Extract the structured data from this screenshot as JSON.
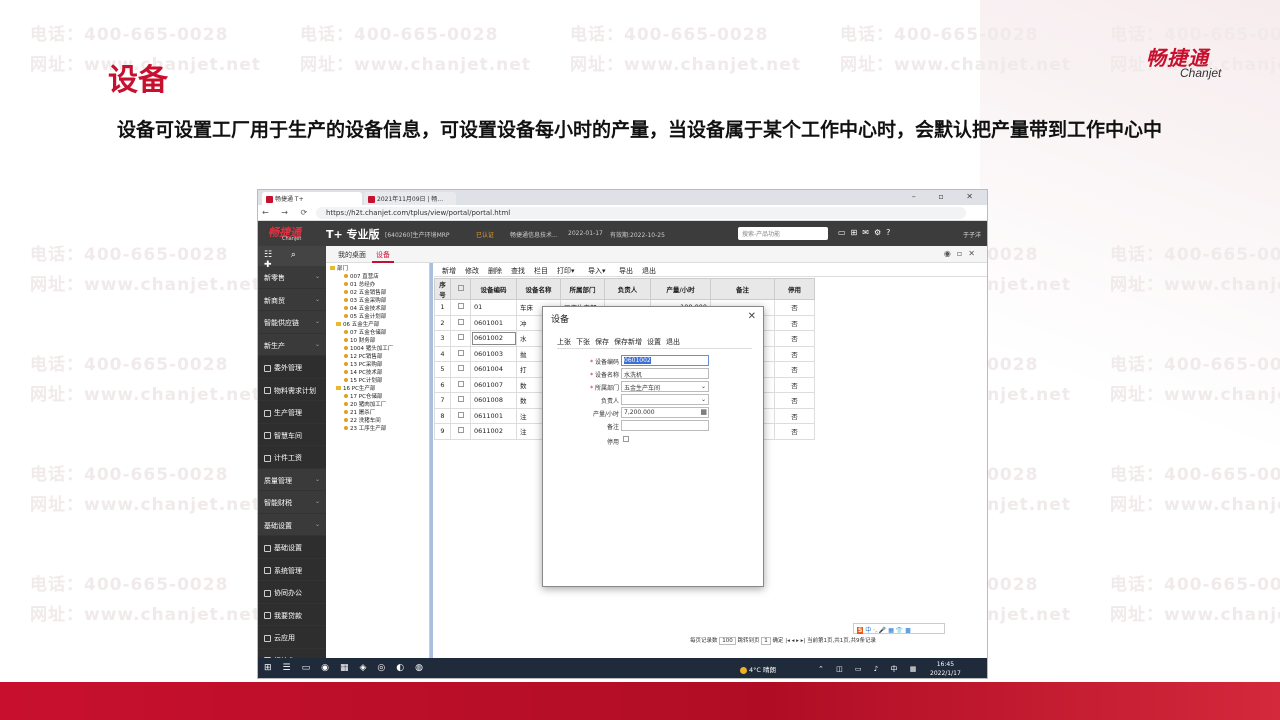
{
  "slide": {
    "title": "设备",
    "description": "设备可设置工厂用于生产的设备信息，可设置设备每小时的产量，当设备属于某个工作中心时，会默认把产量带到工作中心中",
    "logo_cn": "畅捷通",
    "logo_en": "Chanjet",
    "watermark_phone": "电话：400-665-0028",
    "watermark_site": "网址：www.chanjet.net"
  },
  "browser": {
    "tab1": "畅捷通 T+",
    "tab2": "2021年11月09日 | 畅...",
    "url": "https://h2t.chanjet.com/tplus/view/portal/portal.html"
  },
  "app": {
    "logo": "畅捷通",
    "logo_en": "Chanjet",
    "name": "T+ 专业版",
    "version": "[640260]生产环境MRP",
    "cert": "已认证",
    "company": "畅捷通信息技术...",
    "date": "2022-01-17",
    "valid": "有效期:2022-10-25",
    "search_placeholder": "搜索-产品功能",
    "user": "于子洋"
  },
  "sidebar": {
    "items": [
      {
        "label": "新零售",
        "sub": false
      },
      {
        "label": "新商贸",
        "sub": false
      },
      {
        "label": "智能供应链",
        "sub": false
      },
      {
        "label": "新生产",
        "sub": false
      },
      {
        "label": "委外管理",
        "sub": true
      },
      {
        "label": "物料需求计划",
        "sub": true
      },
      {
        "label": "生产管理",
        "sub": true
      },
      {
        "label": "智慧车间",
        "sub": true
      },
      {
        "label": "计件工资",
        "sub": true
      },
      {
        "label": "质量管理",
        "sub": false
      },
      {
        "label": "智能财税",
        "sub": false
      },
      {
        "label": "基础设置",
        "sub": false
      },
      {
        "label": "基础设置",
        "sub": true
      },
      {
        "label": "系统管理",
        "sub": true
      },
      {
        "label": "协同办公",
        "sub": true
      },
      {
        "label": "我要贷款",
        "sub": true
      },
      {
        "label": "云应用",
        "sub": true
      },
      {
        "label": "初始化",
        "sub": true
      }
    ]
  },
  "pagetabs": {
    "home": "我的桌面",
    "device": "设备"
  },
  "tree": [
    "部门",
    "007 直营店",
    "01 总经办",
    "02 五金销售部",
    "03 五金采购部",
    "04 五金技术部",
    "05 五金计划部",
    "06 五金生产部",
    "07 五金仓储部",
    "10 财务部",
    "1004 猪头加工厂",
    "12 PC销售部",
    "13 PC采购部",
    "14 PC技术部",
    "15 PC计划部",
    "16 PC生产部",
    "17 PC仓储部",
    "20 猪肉加工厂",
    "21 屠杀厂",
    "22 洗猪车间",
    "23 工序生产部"
  ],
  "toolbar": [
    "新增",
    "修改",
    "删除",
    "查找",
    "栏目",
    "打印▾",
    "导入▾",
    "导出",
    "退出"
  ],
  "grid": {
    "headers": [
      "序号",
      "",
      "设备编码",
      "设备名称",
      "所属部门",
      "负责人",
      "产量/小时",
      "备注",
      "停用"
    ],
    "rows": [
      [
        "1",
        "01",
        "车床",
        "工序生产部",
        "",
        "100.000",
        "",
        "否"
      ],
      [
        "2",
        "0601001",
        "冲",
        "",
        "",
        "",
        "",
        "否"
      ],
      [
        "3",
        "0601002",
        "水",
        "",
        "",
        "",
        "",
        "否"
      ],
      [
        "4",
        "0601003",
        "抛",
        "",
        "",
        "",
        "",
        "否"
      ],
      [
        "5",
        "0601004",
        "打",
        "",
        "",
        "",
        "",
        "否"
      ],
      [
        "6",
        "0601007",
        "数",
        "",
        "",
        "",
        "",
        "否"
      ],
      [
        "7",
        "0601008",
        "数",
        "",
        "",
        "",
        "",
        "否"
      ],
      [
        "8",
        "0611001",
        "注",
        "",
        "",
        "",
        "",
        "否"
      ],
      [
        "9",
        "0611002",
        "注",
        "",
        "",
        "",
        "",
        "否"
      ]
    ]
  },
  "modal": {
    "title": "设备",
    "toolbar": [
      "上张",
      "下张",
      "保存",
      "保存新增",
      "设置",
      "退出"
    ],
    "fields": {
      "code_label": "设备编码",
      "code": "0601002",
      "name_label": "设备名称",
      "name": "水洗机",
      "dept_label": "所属部门",
      "dept": "五金生产车间",
      "owner_label": "负责人",
      "owner": "",
      "rate_label": "产量/小时",
      "rate": "7,200.000",
      "note_label": "备注",
      "note": "",
      "disabled_label": "停用"
    }
  },
  "status": {
    "per_page_label": "每页记录数",
    "per_page": "100",
    "jump_label": "跳转到页",
    "jump": "1",
    "confirm": "确定",
    "info": "当前第1页,共1页,共9条记录"
  },
  "ime": "中 ·, 🎤 ▦ 👕 ▩",
  "taskbar": {
    "weather": "4°C 晴朗",
    "ime": "中",
    "time": "16:45",
    "date": "2022/1/17"
  },
  "colors": {
    "brand_red": "#c8102e",
    "sidebar_dark": "#3a3a3a"
  }
}
